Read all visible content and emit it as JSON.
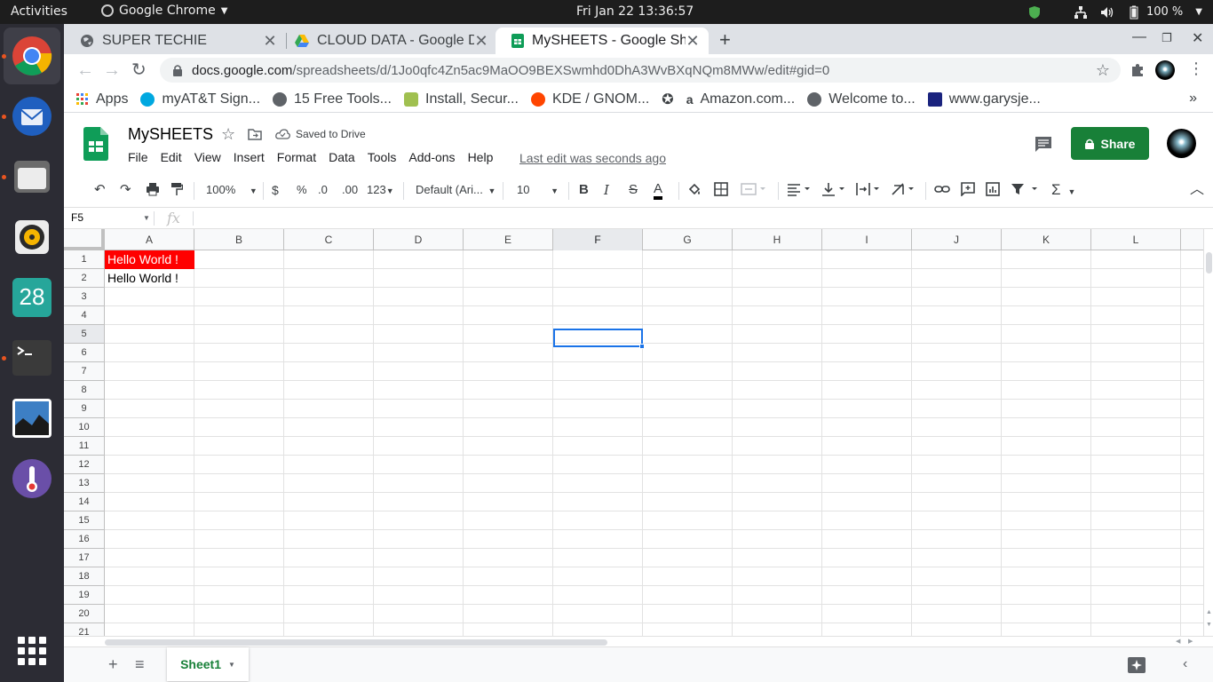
{
  "system": {
    "activities": "Activities",
    "app_name": "Google Chrome",
    "clock": "Fri Jan 22  13:36:57",
    "battery": "100 %"
  },
  "dock": {
    "apps": [
      "chrome",
      "thunderbird",
      "files",
      "rhythmbox",
      "calendar",
      "terminal",
      "maps",
      "thermometer"
    ],
    "calendar_day": "28"
  },
  "tabs": [
    {
      "title": "SUPER TECHIE",
      "icon": "globe-icon"
    },
    {
      "title": "CLOUD DATA - Google Drive",
      "icon": "google-drive-icon"
    },
    {
      "title": "MySHEETS - Google Sheets",
      "icon": "sheets-icon"
    }
  ],
  "omnibox": {
    "host": "docs.google.com",
    "path": "/spreadsheets/d/1Jo0qfc4Zn5ac9MaOO9BEXSwmhd0DhA3WvBXqNQm8MWw/edit#gid=0"
  },
  "bookmarks": [
    {
      "label": "Apps",
      "color": "#ea4335"
    },
    {
      "label": "myAT&T Sign...",
      "color": "#00a8e0"
    },
    {
      "label": "15 Free Tools...",
      "color": "#5f6368"
    },
    {
      "label": "Install, Secur...",
      "color": "#a0c050"
    },
    {
      "label": "KDE / GNOM...",
      "color": "#ff4500"
    },
    {
      "label": "Amazon.com...",
      "color": "#000000"
    },
    {
      "label": "Welcome to...",
      "color": "#5f6368"
    },
    {
      "label": "www.garysje...",
      "color": "#1a237e"
    }
  ],
  "sheet": {
    "title": "MySHEETS",
    "saved_status": "Saved to Drive",
    "menu": [
      "File",
      "Edit",
      "View",
      "Insert",
      "Format",
      "Data",
      "Tools",
      "Add-ons",
      "Help"
    ],
    "last_edit": "Last edit was seconds ago",
    "share_label": "Share"
  },
  "toolbar": {
    "zoom": "100%",
    "currency": "$",
    "percent": "%",
    "decrease_decimal": ".0",
    "increase_decimal": ".00",
    "number_format": "123",
    "font": "Default (Ari...",
    "font_size": "10",
    "bold": "B",
    "italic": "I",
    "strike": "S",
    "text_color": "A",
    "function": "Σ"
  },
  "formula_bar": {
    "name_box": "F5",
    "fx": "fx",
    "value": ""
  },
  "grid": {
    "columns": [
      "A",
      "B",
      "C",
      "D",
      "E",
      "F",
      "G",
      "H",
      "I",
      "J",
      "K",
      "L"
    ],
    "rows": [
      "1",
      "2",
      "3",
      "4",
      "5",
      "6",
      "7",
      "8",
      "9",
      "10",
      "11",
      "12",
      "13",
      "14",
      "15",
      "16",
      "17",
      "18",
      "19",
      "20",
      "21"
    ],
    "selected_cell": "F5",
    "cells": {
      "A1": {
        "value": "Hello World !",
        "background": "#ff0000",
        "color": "#ffffff"
      },
      "A2": {
        "value": "Hello World !",
        "background": "",
        "color": "#000000"
      }
    }
  },
  "sheet_tabs": [
    "Sheet1"
  ]
}
